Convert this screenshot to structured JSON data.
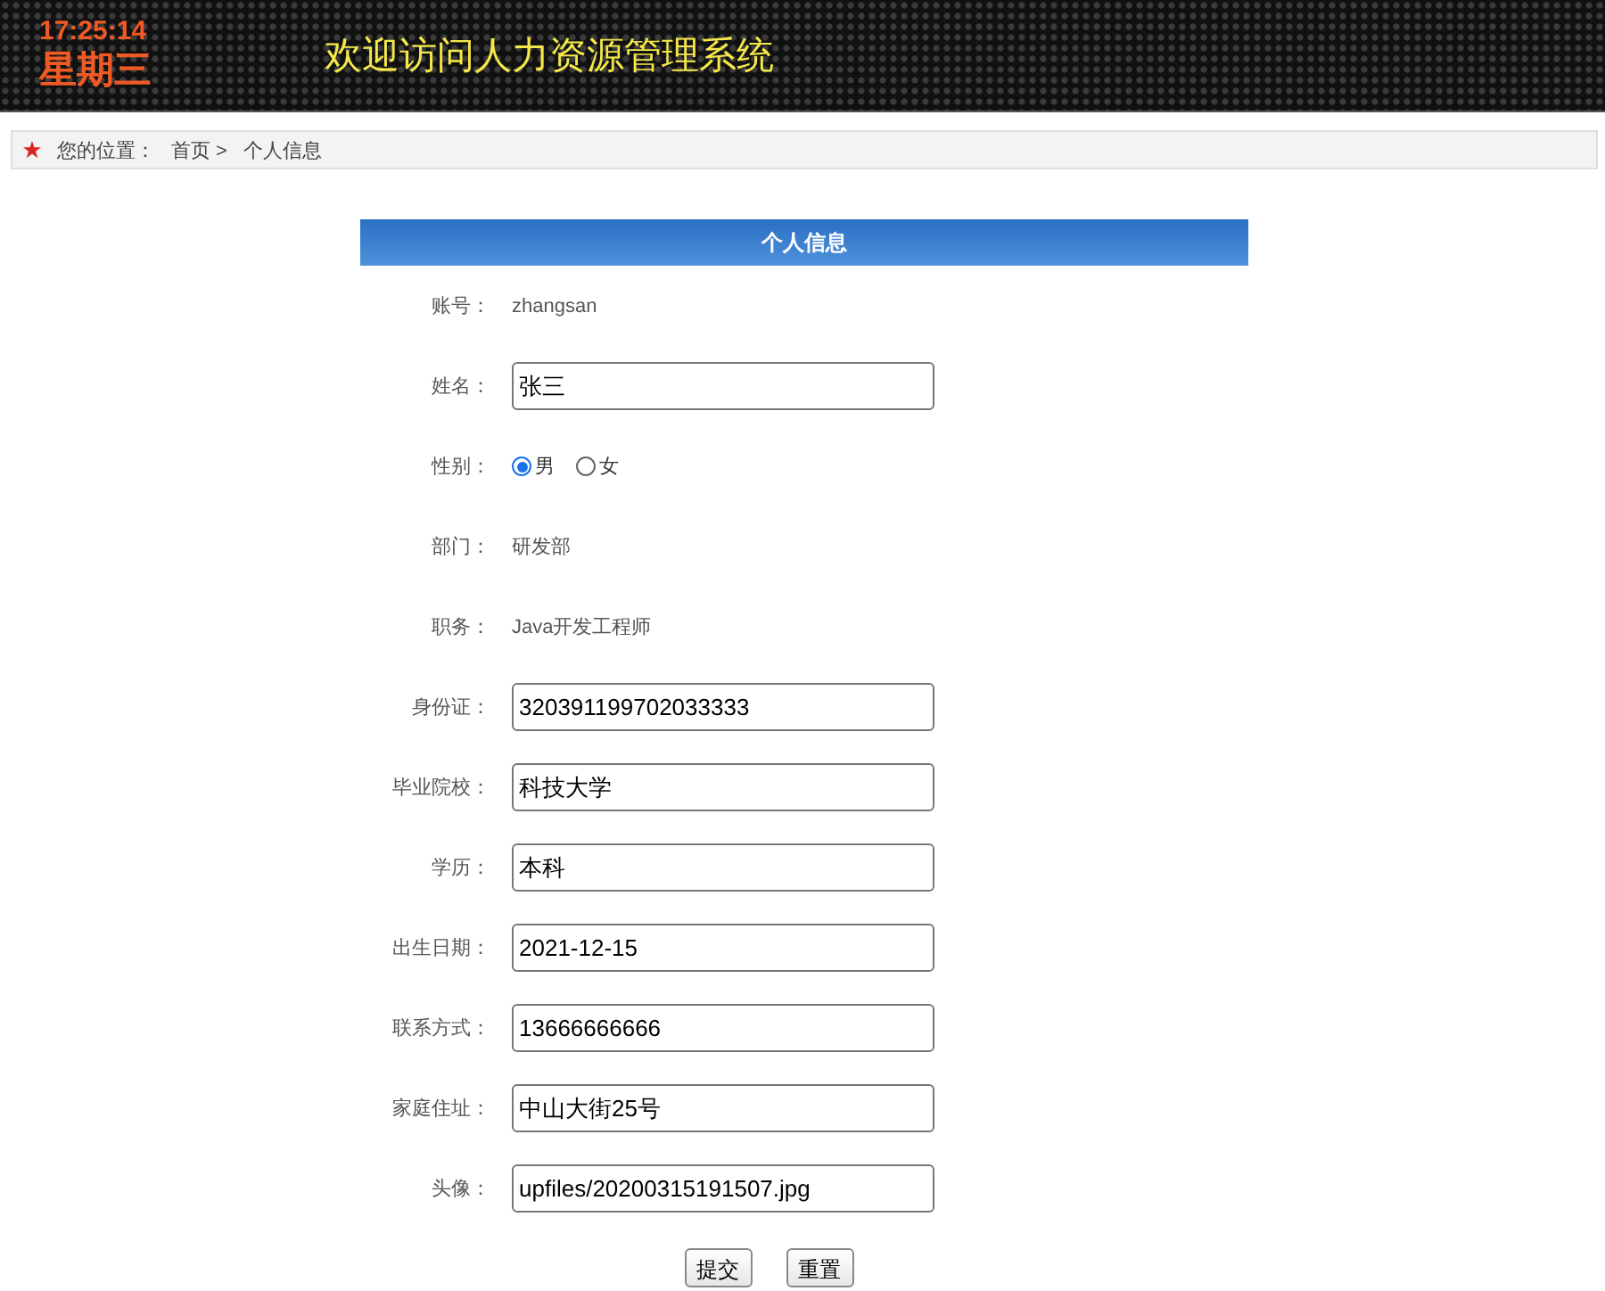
{
  "header": {
    "time": "17:25:14",
    "weekday": "星期三",
    "title": "欢迎访问人力资源管理系统"
  },
  "breadcrumb": {
    "label": "您的位置：",
    "items": [
      "首页 >",
      "个人信息"
    ]
  },
  "panel": {
    "title": "个人信息"
  },
  "rows": [
    {
      "label": "账号：",
      "kind": "text",
      "value": "zhangsan"
    },
    {
      "label": "姓名：",
      "kind": "input",
      "value": "张三"
    },
    {
      "label": "性别：",
      "kind": "radio",
      "options": [
        {
          "label": "男",
          "selected": true
        },
        {
          "label": "女",
          "selected": false
        }
      ]
    },
    {
      "label": "部门：",
      "kind": "text",
      "value": "研发部"
    },
    {
      "label": "职务：",
      "kind": "text",
      "value": "Java开发工程师"
    },
    {
      "label": "身份证：",
      "kind": "input",
      "value": "320391199702033333"
    },
    {
      "label": "毕业院校：",
      "kind": "input",
      "value": "科技大学"
    },
    {
      "label": "学历：",
      "kind": "input",
      "value": "本科"
    },
    {
      "label": "出生日期：",
      "kind": "input",
      "value": "2021-12-15"
    },
    {
      "label": "联系方式：",
      "kind": "input",
      "value": "13666666666"
    },
    {
      "label": "家庭住址：",
      "kind": "input",
      "value": "中山大街25号"
    },
    {
      "label": "头像：",
      "kind": "input",
      "value": "upfiles/20200315191507.jpg"
    }
  ],
  "buttons": [
    "提交",
    "重置"
  ]
}
